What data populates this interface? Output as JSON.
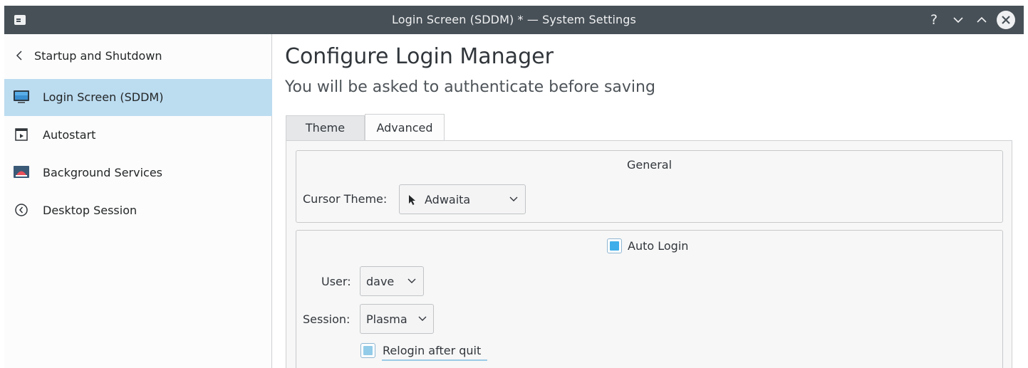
{
  "window": {
    "title": "Login Screen (SDDM) * — System Settings",
    "buttons": {
      "help": "?",
      "minimize": "⌄",
      "maximize": "⌃"
    }
  },
  "sidebar": {
    "back_label": "Startup and Shutdown",
    "items": [
      {
        "label": "Login Screen (SDDM)",
        "icon": "monitor-icon",
        "selected": true
      },
      {
        "label": "Autostart",
        "icon": "autostart-icon",
        "selected": false
      },
      {
        "label": "Background Services",
        "icon": "background-services-icon",
        "selected": false
      },
      {
        "label": "Desktop Session",
        "icon": "desktop-session-icon",
        "selected": false
      }
    ]
  },
  "main": {
    "title": "Configure Login Manager",
    "subtitle": "You will be asked to authenticate before saving",
    "tabs": [
      {
        "label": "Theme",
        "active": false
      },
      {
        "label": "Advanced",
        "active": true
      }
    ],
    "general": {
      "title": "General",
      "cursor_theme_label": "Cursor Theme:",
      "cursor_theme_value": "Adwaita"
    },
    "auto_login": {
      "checkbox_label": "Auto Login",
      "checked": true,
      "user_label": "User:",
      "user_value": "dave",
      "session_label": "Session:",
      "session_value": "Plasma",
      "relogin_label": "Relogin after quit",
      "relogin_checked": true
    }
  },
  "colors": {
    "titlebar": "#475057",
    "selection": "#bcdcf0",
    "accent": "#3daee9"
  }
}
